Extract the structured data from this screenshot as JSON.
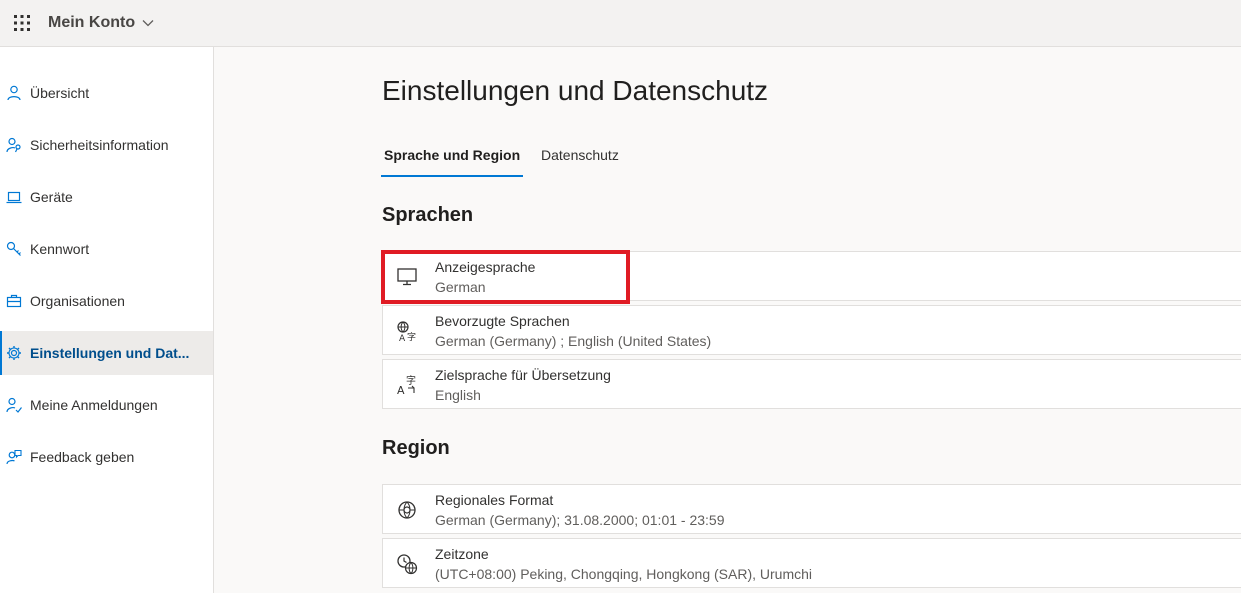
{
  "header": {
    "app_title": "Mein Konto",
    "icons": [
      "waffle-icon",
      "chevron-down-icon"
    ]
  },
  "sidebar": {
    "items": [
      {
        "label": "Übersicht",
        "icon": "person-icon",
        "active": false
      },
      {
        "label": "Sicherheitsinformation",
        "icon": "person-key-icon",
        "active": false
      },
      {
        "label": "Geräte",
        "icon": "laptop-icon",
        "active": false
      },
      {
        "label": "Kennwort",
        "icon": "key-icon",
        "active": false
      },
      {
        "label": "Organisationen",
        "icon": "briefcase-icon",
        "active": false
      },
      {
        "label": "Einstellungen und Dat...",
        "icon": "gear-icon",
        "active": true
      },
      {
        "label": "Meine Anmeldungen",
        "icon": "person-sign-in-icon",
        "active": false
      },
      {
        "label": "Feedback geben",
        "icon": "person-feedback-icon",
        "active": false
      }
    ]
  },
  "main": {
    "title": "Einstellungen und Datenschutz",
    "tabs": [
      {
        "label": "Sprache und Region",
        "active": true
      },
      {
        "label": "Datenschutz",
        "active": false
      }
    ],
    "sections": [
      {
        "title": "Sprachen",
        "cards": [
          {
            "title": "Anzeigesprache",
            "value": "German",
            "icon": "monitor-icon"
          },
          {
            "title": "Bevorzugte Sprachen",
            "value": "German (Germany) ; English (United States)",
            "icon": "globe-translate-icon"
          },
          {
            "title": "Zielsprache für Übersetzung",
            "value": "English",
            "icon": "translate-icon"
          }
        ]
      },
      {
        "title": "Region",
        "cards": [
          {
            "title": "Regionales Format",
            "value": "German (Germany); 31.08.2000; 01:01 - 23:59",
            "icon": "globe-format-icon"
          },
          {
            "title": "Zeitzone",
            "value": "(UTC+08:00) Peking, Chongqing, Hongkong (SAR), Urumchi",
            "icon": "clock-globe-icon"
          }
        ]
      }
    ]
  },
  "colors": {
    "accent": "#0078d4",
    "active_text": "#004e8c",
    "highlight_box": "#e01b24"
  }
}
